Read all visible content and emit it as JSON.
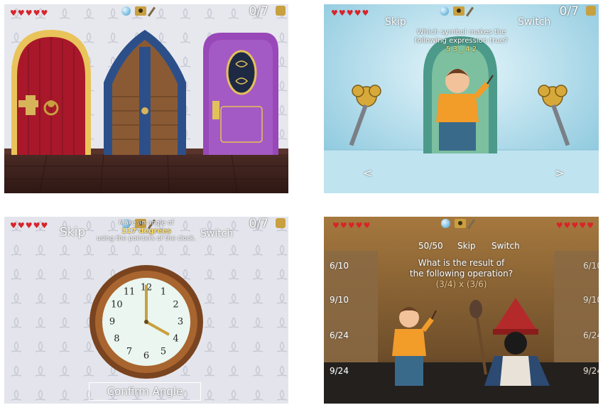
{
  "panel1": {
    "score": "0/7",
    "hearts": "♥♥♥♥♥"
  },
  "panel2": {
    "score": "0/7",
    "hearts": "♥♥♥♥♥",
    "skip": "Skip",
    "switch": "Switch",
    "question_line1": "Which symbol makes the",
    "question_line2": "following expression true?",
    "expression": "5 3 _ 4 2",
    "nav_prev": "<",
    "nav_next": ">"
  },
  "panel3": {
    "score": "0/7",
    "hearts": "♥♥♥♥♥",
    "skip": "Skip",
    "switch": "Switch",
    "prompt_line1": "Make an angle of",
    "angle": "117 degrees",
    "prompt_line2": "using the pointers of the clock.",
    "confirm": "Confirm Angle",
    "clock_numbers": [
      "12",
      "1",
      "2",
      "3",
      "4",
      "5",
      "6",
      "7",
      "8",
      "9",
      "10",
      "11"
    ]
  },
  "panel4": {
    "hearts_left": "♥♥♥♥♥",
    "hearts_right": "♥♥♥♥♥",
    "fifty": "50/50",
    "skip": "Skip",
    "switch": "Switch",
    "question_line1": "What is the result of",
    "question_line2": "the following operation?",
    "operation": "(3/4) x (3/6)",
    "answers": [
      "6/10",
      "9/10",
      "6/24",
      "9/24"
    ]
  }
}
